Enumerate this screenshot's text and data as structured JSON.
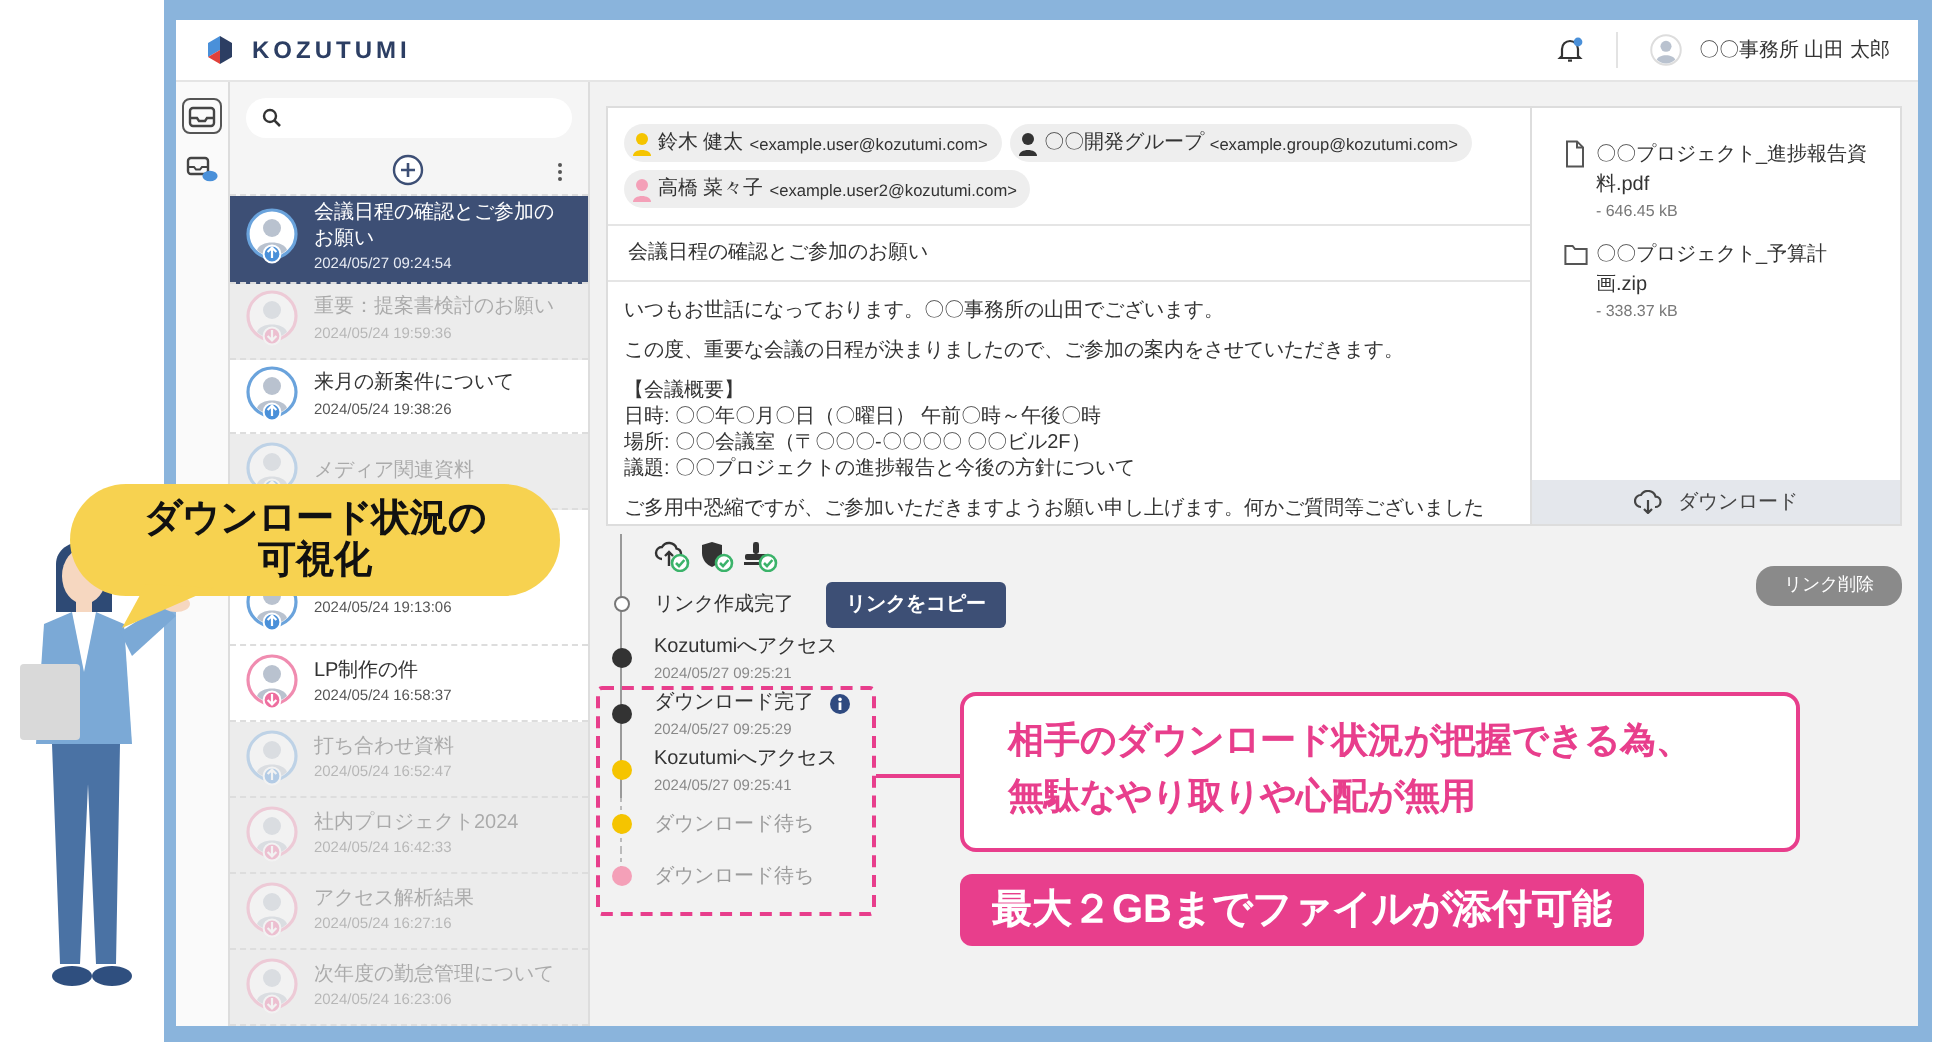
{
  "header": {
    "logo": "KOZUTUMI",
    "unread": true,
    "user": "〇〇事務所 山田 太郎"
  },
  "rail": [
    {
      "kind": "inbox",
      "selected": true
    },
    {
      "kind": "cloud-inbox",
      "selected": false
    }
  ],
  "list": {
    "items": [
      {
        "title": "会議日程の確認とご参加のお願い",
        "date": "2024/05/27 09:24:54",
        "kind": "sent",
        "selected": true,
        "faded": false
      },
      {
        "title": "重要：提案書検討のお願い",
        "date": "2024/05/24 19:59:36",
        "kind": "received",
        "selected": false,
        "faded": true
      },
      {
        "title": "来月の新案件について",
        "date": "2024/05/24 19:38:26",
        "kind": "sent",
        "selected": false,
        "faded": false
      },
      {
        "title": "メディア関連資料",
        "kind": "sent",
        "selected": false,
        "faded": true
      },
      {
        "date": "2024/05/24 19:13:06",
        "kind": "sent",
        "selected": false,
        "faded": false
      },
      {
        "title": "LP制作の件",
        "date": "2024/05/24 16:58:37",
        "kind": "received",
        "selected": false,
        "faded": false
      },
      {
        "title": "打ち合わせ資料",
        "date": "2024/05/24 16:52:47",
        "kind": "sent",
        "selected": false,
        "faded": true
      },
      {
        "title": "社内プロジェクト2024",
        "date": "2024/05/24 16:42:33",
        "kind": "received",
        "selected": false,
        "faded": true
      },
      {
        "title": "アクセス解析結果",
        "date": "2024/05/24 16:27:16",
        "kind": "received",
        "selected": false,
        "faded": true
      },
      {
        "title": "次年度の勤怠管理について",
        "date": "2024/05/24 16:23:06",
        "kind": "received",
        "selected": false,
        "faded": true
      }
    ]
  },
  "email": {
    "recipients": [
      {
        "name": "鈴木 健太",
        "address": "<example.user@kozutumi.com>",
        "color": "#f5c400"
      },
      {
        "name": "〇〇開発グループ",
        "address": "<example.group@kozutumi.com>",
        "color": "#333333"
      },
      {
        "name": "高橋 菜々子",
        "address": "<example.user2@kozutumi.com>",
        "color": "#f4a0b8"
      }
    ],
    "subject": "会議日程の確認とご参加のお願い",
    "body": [
      [
        "いつもお世話になっております。〇〇事務所の山田でございます。"
      ],
      [
        "この度、重要な会議の日程が決まりましたので、ご参加の案内をさせていただきます。"
      ],
      [
        "【会議概要】",
        "日時: 〇〇年〇月〇日（〇曜日） 午前〇時～午後〇時",
        "場所: 〇〇会議室（〒〇〇〇-〇〇〇〇 〇〇ビル2F）",
        "議題: 〇〇プロジェクトの進捗報告と今後の方針について"
      ],
      [
        "ご多用中恐縮ですが、ご参加いただきますようお願い申し上げます。何かご質問等ございました"
      ]
    ]
  },
  "files": {
    "items": [
      {
        "kind": "document",
        "name": "〇〇プロジェクト_進捗報告資料.pdf",
        "size": "- 646.45 kB"
      },
      {
        "kind": "folder",
        "name": "〇〇プロジェクト_予算計画.zip",
        "size": "- 338.37 kB"
      }
    ],
    "download_button": "ダウンロード"
  },
  "timeline": {
    "created": {
      "label": "リンク作成完了",
      "button": "リンクをコピー"
    },
    "events": [
      {
        "label": "Kozutumiへアクセス",
        "time": "2024/05/27 09:25:21",
        "color": "#333333",
        "pending": false,
        "info": false
      },
      {
        "label": "ダウンロード完了",
        "time": "2024/05/27 09:25:29",
        "color": "#333333",
        "pending": false,
        "info": true
      },
      {
        "label": "Kozutumiへアクセス",
        "time": "2024/05/27 09:25:41",
        "color": "#f5c400",
        "pending": false,
        "info": false
      },
      {
        "label": "ダウンロード待ち",
        "color": "#f5c400",
        "pending": true,
        "info": false
      },
      {
        "label": "ダウンロード待ち",
        "color": "#f4a0b8",
        "pending": true,
        "info": false
      }
    ],
    "delete_button": "リンク削除"
  },
  "callouts": {
    "bubble": "ダウンロード状況の可視化",
    "note": "相手のダウンロード状況が把握できる為、無駄なやり取りや心配が無用",
    "label": "最大２GBまでファイルが添付可能"
  }
}
